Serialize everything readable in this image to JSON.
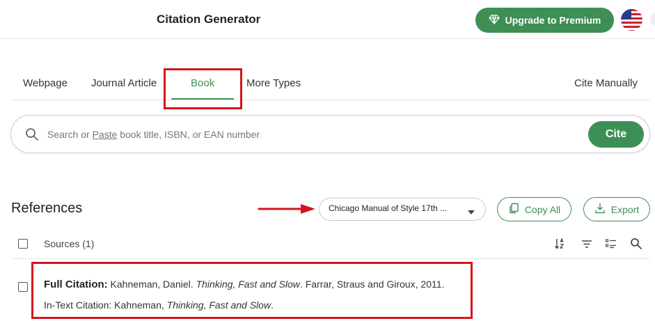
{
  "header": {
    "title": "Citation Generator",
    "premium_label": "Upgrade to Premium"
  },
  "tabs": [
    {
      "label": "Webpage"
    },
    {
      "label": "Journal Article"
    },
    {
      "label": "Book",
      "active": true
    },
    {
      "label": "More Types"
    }
  ],
  "cite_manually_label": "Cite Manually",
  "search": {
    "placeholder_pre": "Search or ",
    "placeholder_link": "Paste",
    "placeholder_post": " book title, ISBN, or EAN number",
    "button_label": "Cite"
  },
  "references": {
    "heading": "References",
    "style_selected": "Chicago Manual of Style 17th ...",
    "copy_all_label": "Copy All",
    "export_label": "Export",
    "sources_label": "Sources (1)"
  },
  "citation": {
    "full_label": "Full Citation:",
    "full_author": "Kahneman, Daniel.",
    "full_title": "Thinking, Fast and Slow",
    "full_rest": ". Farrar, Straus and Giroux, 2011.",
    "intext_label": "In-Text Citation:",
    "intext_author": "Kahneman,",
    "intext_title": "Thinking, Fast and Slow",
    "intext_end": "."
  },
  "colors": {
    "accent": "#3e8f55",
    "annotation_red": "#d6141c"
  },
  "icons": {
    "premium": "diamond-icon",
    "search": "search-icon",
    "copy": "copy-icon",
    "export": "download-icon",
    "sort": "sort-icon",
    "filter": "filter-icon",
    "list": "list-icon",
    "find": "search-icon",
    "flag": "us-flag-icon"
  }
}
